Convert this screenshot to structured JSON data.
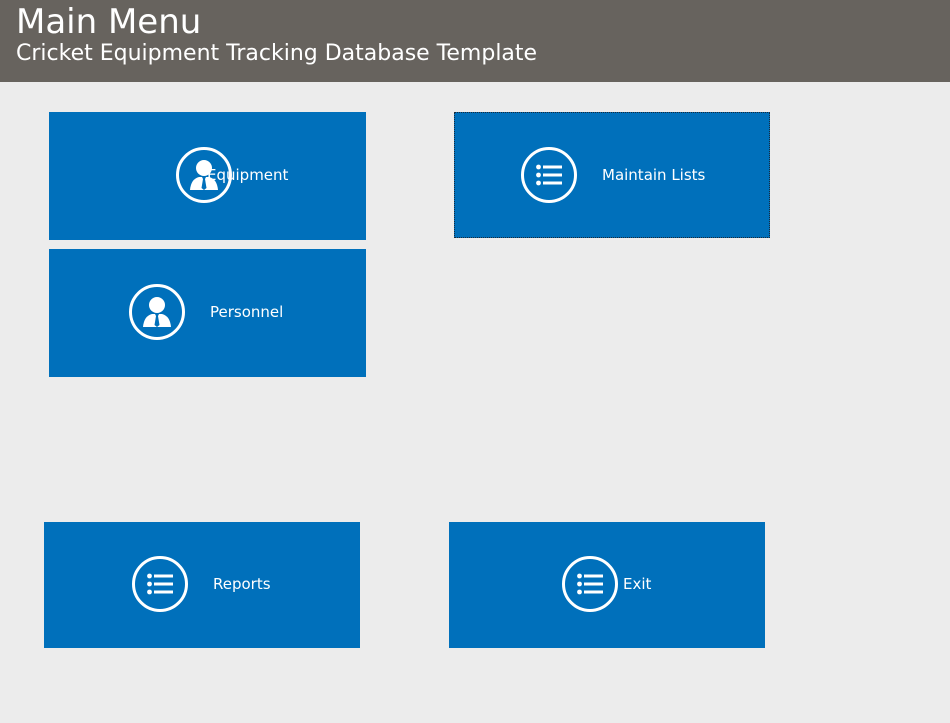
{
  "header": {
    "title": "Main Menu",
    "subtitle": "Cricket Equipment Tracking Database Template"
  },
  "tiles": [
    {
      "label": "Equipment",
      "icon": "person-icon"
    },
    {
      "label": "Maintain Lists",
      "icon": "list-icon"
    },
    {
      "label": "Personnel",
      "icon": "person-icon"
    },
    {
      "label": "Reports",
      "icon": "list-icon"
    },
    {
      "label": "Exit",
      "icon": "list-icon"
    }
  ],
  "colors": {
    "header_bg": "#67635e",
    "page_bg": "#ececec",
    "tile_bg": "#0070bb",
    "text": "#ffffff"
  }
}
